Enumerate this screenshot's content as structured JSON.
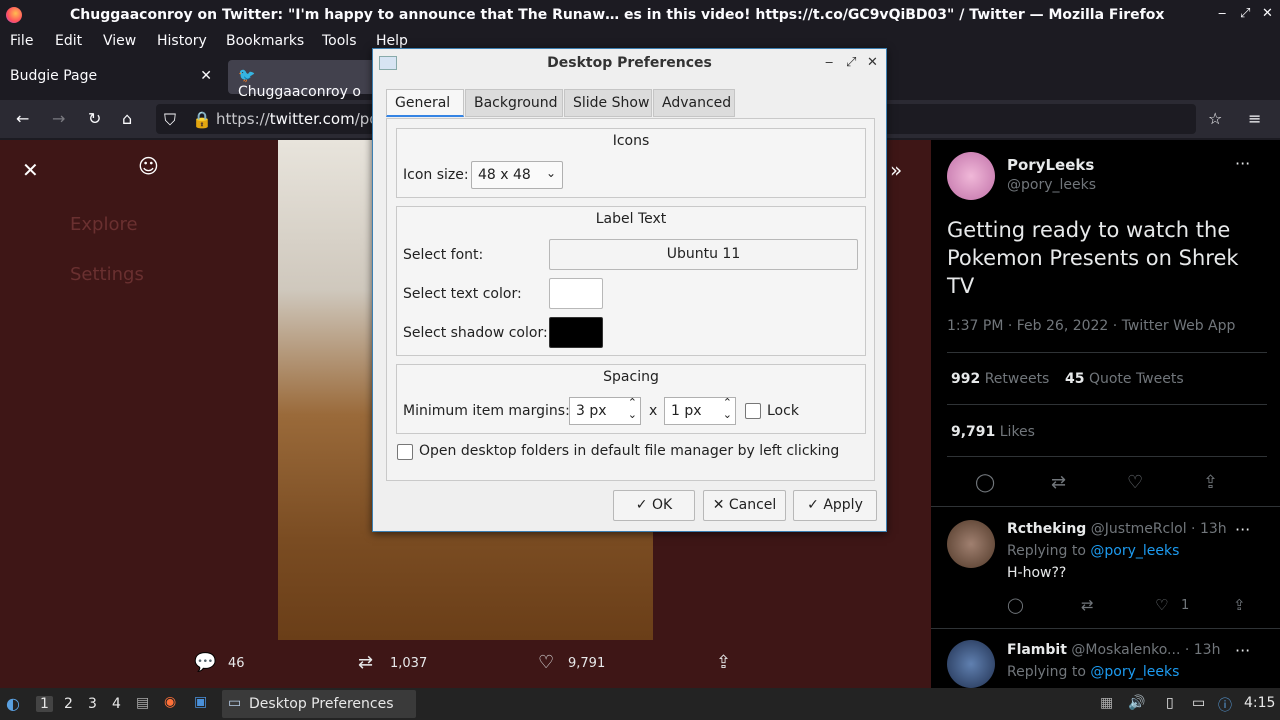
{
  "window": {
    "title": "Chuggaaconroy on Twitter: \"I'm happy to announce that The Runaw… es in this video! https://t.co/GC9vQiBD03\" / Twitter — Mozilla Firefox",
    "controls": [
      "‒",
      "⤢",
      "✕"
    ]
  },
  "menubar": {
    "items": [
      "File",
      "Edit",
      "View",
      "History",
      "Bookmarks",
      "Tools",
      "Help"
    ]
  },
  "tabs": [
    {
      "label": "Budgie Page",
      "close": "✕"
    },
    {
      "label": "Chuggaaconroy o"
    }
  ],
  "url": {
    "prefix": "https://",
    "domain": "twitter.com",
    "rest": "/por"
  },
  "side_menu": [
    "Explore",
    "Settings"
  ],
  "media_actions": {
    "replies": "46",
    "retweets": "1,037",
    "likes": "9,791"
  },
  "tweet": {
    "name": "PoryLeeks",
    "handle": "@pory_leeks",
    "text": "Getting ready to watch the Pokemon Presents on Shrek TV",
    "meta": "1:37 PM · Feb 26, 2022 · Twitter Web App",
    "retweets_num": "992",
    "retweets_label": "Retweets",
    "quotes_num": "45",
    "quotes_label": "Quote Tweets",
    "likes_num": "9,791",
    "likes_label": "Likes"
  },
  "replies": [
    {
      "name": "Rctheking",
      "handle": "@JustmeRclol · 13h",
      "replying": "Replying to",
      "to": "@pory_leeks",
      "text": "H-how??",
      "likes": "1"
    },
    {
      "name": "Flambit",
      "handle": "@Moskalenko... · 13h",
      "replying": "Replying to",
      "to": "@pory_leeks"
    }
  ],
  "dialog": {
    "title": "Desktop Preferences",
    "tabs": [
      "General",
      "Background",
      "Slide Show",
      "Advanced"
    ],
    "icons": {
      "heading": "Icons",
      "size_label": "Icon size:",
      "size_value": "48 x 48"
    },
    "label_text": {
      "heading": "Label Text",
      "font_label": "Select font:",
      "font_value": "Ubuntu 11",
      "text_color_label": "Select text color:",
      "text_color": "#ffffff",
      "shadow_color_label": "Select shadow color:",
      "shadow_color": "#000000"
    },
    "spacing": {
      "heading": "Spacing",
      "margins_label": "Minimum item margins:",
      "margin_x": "3 px",
      "times": "x",
      "margin_y": "1 px",
      "lock_label": "Lock"
    },
    "open_folders_label": "Open desktop folders in default file manager by left clicking",
    "buttons": {
      "ok": "OK",
      "cancel": "Cancel",
      "apply": "Apply"
    }
  },
  "taskbar": {
    "workspaces": [
      "1",
      "2",
      "3",
      "4"
    ],
    "active_window": "Desktop Preferences",
    "clock": "4:15"
  }
}
